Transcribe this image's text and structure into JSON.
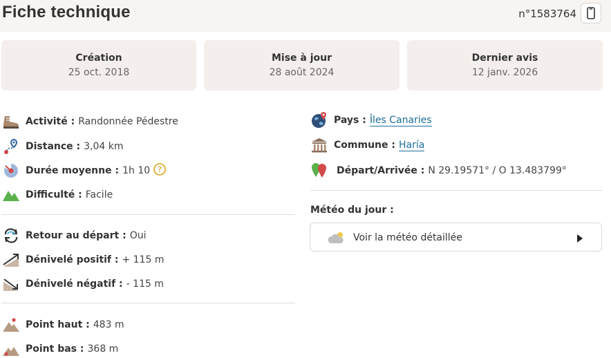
{
  "header": {
    "title": "Fiche technique",
    "reference": "n°1583764"
  },
  "cards": [
    {
      "label": "Création",
      "value": "25 oct. 2018"
    },
    {
      "label": "Mise à jour",
      "value": "28 août 2024"
    },
    {
      "label": "Dernier avis",
      "value": "12 janv. 2026"
    }
  ],
  "left": {
    "activite": {
      "label": "Activité :",
      "value": "Randonnée Pédestre"
    },
    "distance": {
      "label": "Distance :",
      "value": "3,04 km"
    },
    "duree": {
      "label": "Durée moyenne :",
      "value": "1h 10"
    },
    "difficulte": {
      "label": "Difficulté :",
      "value": "Facile"
    },
    "retour": {
      "label": "Retour au départ :",
      "value": "Oui"
    },
    "denivele_pos": {
      "label": "Dénivelé positif :",
      "value": "+ 115 m"
    },
    "denivele_neg": {
      "label": "Dénivelé négatif :",
      "value": "- 115 m"
    },
    "point_haut": {
      "label": "Point haut :",
      "value": "483 m"
    },
    "point_bas": {
      "label": "Point bas :",
      "value": "368 m"
    }
  },
  "right": {
    "pays": {
      "label": "Pays :",
      "value": "Îles Canaries"
    },
    "commune": {
      "label": "Commune :",
      "value": "Haría"
    },
    "depart": {
      "label": "Départ/Arrivée :",
      "value": "N 29.19571° / O 13.483799°"
    }
  },
  "meteo": {
    "title": "Météo du jour :",
    "button_label": "Voir la météo détaillée"
  },
  "icons": {
    "phone": "phone-icon",
    "activite": "hiking-boot-icon",
    "distance": "route-pin-icon",
    "duree": "timer-icon",
    "help": "question-circle-icon",
    "difficulte": "mountain-green-icon",
    "retour": "loop-arrows-icon",
    "denivele_pos": "ascent-icon",
    "denivele_neg": "descent-icon",
    "point_haut": "peak-high-icon",
    "point_bas": "peak-low-icon",
    "pays": "globe-pin-icon",
    "commune": "town-hall-icon",
    "depart": "start-end-pins-icon",
    "meteo": "cloud-icon",
    "play": "play-icon"
  },
  "colors": {
    "accent_link": "#1b6d97",
    "card_bg": "#f4efec",
    "header_bg": "#f7f4f2",
    "difficulty_green": "#5ab04b",
    "help_gold": "#d9a11b"
  }
}
